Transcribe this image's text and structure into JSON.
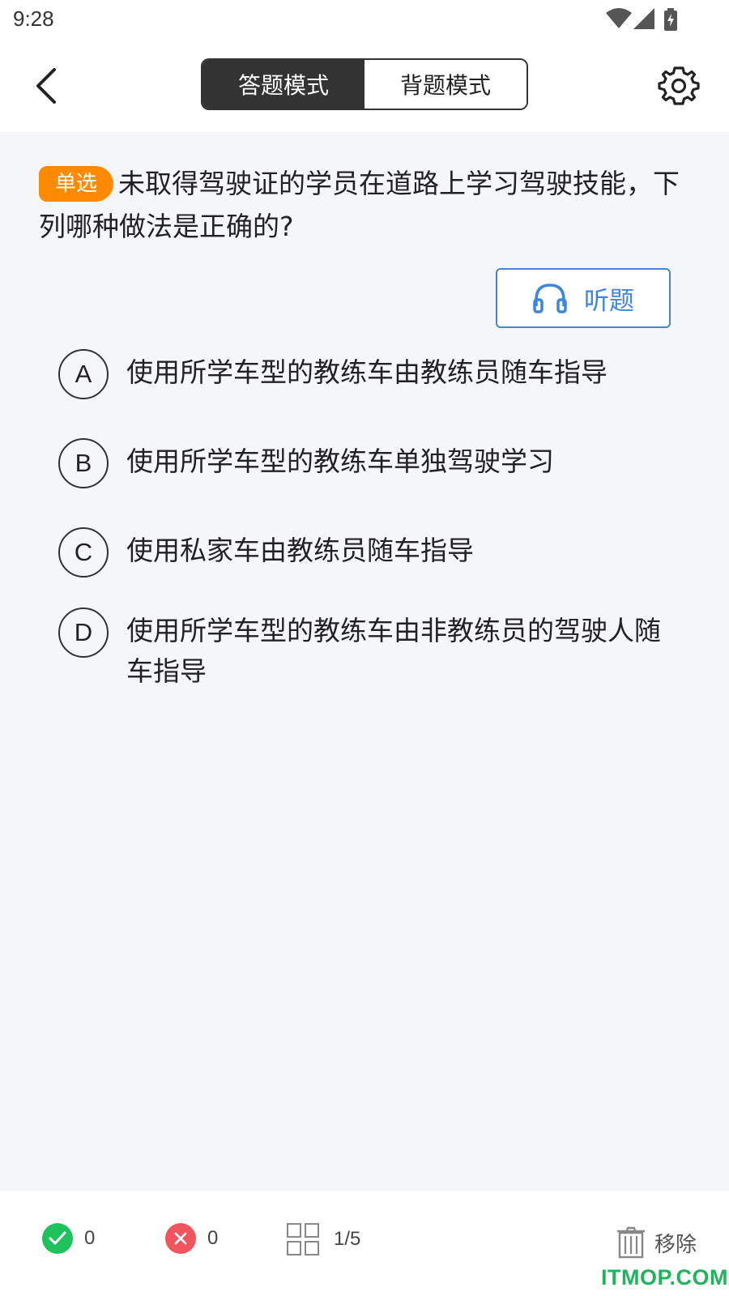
{
  "status_bar": {
    "time": "9:28"
  },
  "header": {
    "tabs": [
      {
        "label": "答题模式",
        "active": true
      },
      {
        "label": "背题模式",
        "active": false
      }
    ]
  },
  "question": {
    "type_label": "单选",
    "text": "未取得驾驶证的学员在道路上学习驾驶技能，下列哪种做法是正确的?"
  },
  "listen_button": {
    "label": "听题",
    "icon": "headphones-icon"
  },
  "options": [
    {
      "key": "A",
      "text": "使用所学车型的教练车由教练员随车指导"
    },
    {
      "key": "B",
      "text": "使用所学车型的教练车单独驾驶学习"
    },
    {
      "key": "C",
      "text": "使用私家车由教练员随车指导"
    },
    {
      "key": "D",
      "text": "使用所学车型的教练车由非教练员的驾驶人随车指导"
    }
  ],
  "footer": {
    "correct_count": "0",
    "wrong_count": "0",
    "progress": "1/5",
    "remove_label": "移除"
  },
  "watermark": "ITMOP.COM",
  "colors": {
    "accent_orange": "#ff8a00",
    "accent_blue": "#3a86e0",
    "correct_green": "#1fc15a",
    "wrong_red": "#f0545c"
  }
}
